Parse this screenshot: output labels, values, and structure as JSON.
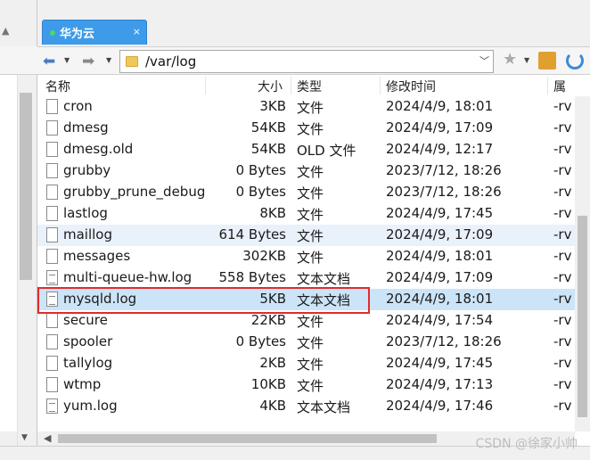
{
  "tab": {
    "title": "华为云",
    "close_glyph": "×"
  },
  "address": {
    "path": "/var/log"
  },
  "columns": {
    "name": "名称",
    "size": "大小",
    "type": "类型",
    "modified": "修改时间",
    "attrs": "属"
  },
  "files": [
    {
      "name": "cron",
      "size": "3KB",
      "type": "文件",
      "modified": "2024/4/9, 18:01",
      "perm": "-rv"
    },
    {
      "name": "dmesg",
      "size": "54KB",
      "type": "文件",
      "modified": "2024/4/9, 17:09",
      "perm": "-rv"
    },
    {
      "name": "dmesg.old",
      "size": "54KB",
      "type": "OLD 文件",
      "modified": "2024/4/9, 12:17",
      "perm": "-rv"
    },
    {
      "name": "grubby",
      "size": "0 Bytes",
      "type": "文件",
      "modified": "2023/7/12, 18:26",
      "perm": "-rv"
    },
    {
      "name": "grubby_prune_debug",
      "size": "0 Bytes",
      "type": "文件",
      "modified": "2023/7/12, 18:26",
      "perm": "-rv"
    },
    {
      "name": "lastlog",
      "size": "8KB",
      "type": "文件",
      "modified": "2024/4/9, 17:45",
      "perm": "-rv"
    },
    {
      "name": "maillog",
      "size": "614 Bytes",
      "type": "文件",
      "modified": "2024/4/9, 17:09",
      "perm": "-rv"
    },
    {
      "name": "messages",
      "size": "302KB",
      "type": "文件",
      "modified": "2024/4/9, 18:01",
      "perm": "-rv"
    },
    {
      "name": "multi-queue-hw.log",
      "size": "558 Bytes",
      "type": "文本文档",
      "modified": "2024/4/9, 17:09",
      "perm": "-rv"
    },
    {
      "name": "mysqld.log",
      "size": "5KB",
      "type": "文本文档",
      "modified": "2024/4/9, 18:01",
      "perm": "-rv"
    },
    {
      "name": "secure",
      "size": "22KB",
      "type": "文件",
      "modified": "2024/4/9, 17:54",
      "perm": "-rv"
    },
    {
      "name": "spooler",
      "size": "0 Bytes",
      "type": "文件",
      "modified": "2023/7/12, 18:26",
      "perm": "-rv"
    },
    {
      "name": "tallylog",
      "size": "2KB",
      "type": "文件",
      "modified": "2024/4/9, 17:45",
      "perm": "-rv"
    },
    {
      "name": "wtmp",
      "size": "10KB",
      "type": "文件",
      "modified": "2024/4/9, 17:13",
      "perm": "-rv"
    },
    {
      "name": "yum.log",
      "size": "4KB",
      "type": "文本文档",
      "modified": "2024/4/9, 17:46",
      "perm": "-rv"
    }
  ],
  "watermark": "CSDN @徐家小帅",
  "colors": {
    "tab_accent": "#3d9be9",
    "selected_row": "#cce4f7",
    "highlight_box": "#e12b2b"
  }
}
